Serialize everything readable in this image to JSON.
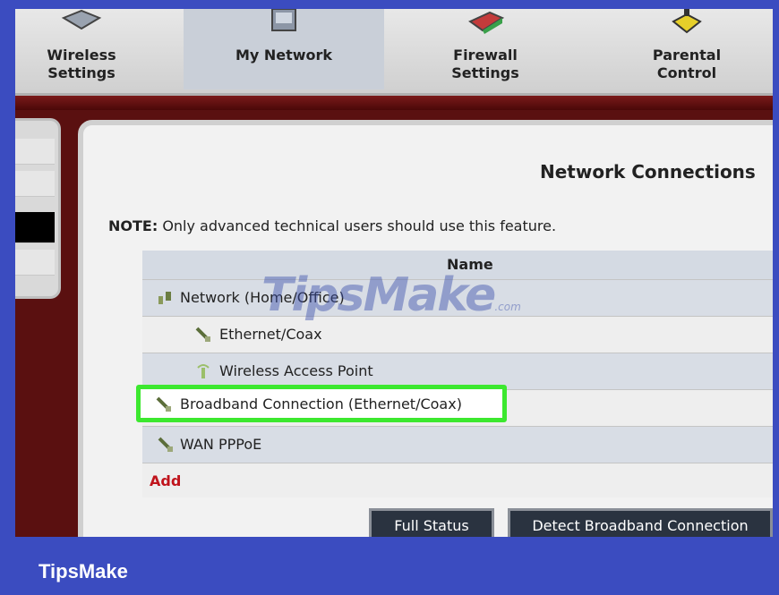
{
  "nav": {
    "items": [
      {
        "label_line1": "Wireless",
        "label_line2": "Settings",
        "icon": "router-icon"
      },
      {
        "label_line1": "My Network",
        "label_line2": "",
        "icon": "computer-icon"
      },
      {
        "label_line1": "Firewall",
        "label_line2": "Settings",
        "icon": "firewall-icon"
      },
      {
        "label_line1": "Parental",
        "label_line2": "Control",
        "icon": "parental-icon"
      }
    ],
    "active_index": 1
  },
  "main": {
    "title": "Network Connections",
    "note_label": "NOTE:",
    "note_text": " Only advanced technical users should use this feature.",
    "table_header": "Name",
    "rows": [
      {
        "label": "Network (Home/Office)",
        "icon": "network-icon"
      },
      {
        "label": "Ethernet/Coax",
        "icon": "cable-icon"
      },
      {
        "label": "Wireless Access Point",
        "icon": "wireless-icon"
      },
      {
        "label": "Broadband Connection (Ethernet/Coax)",
        "icon": "cable-icon",
        "highlighted": true
      },
      {
        "label": "WAN PPPoE",
        "icon": "cable-icon"
      }
    ],
    "add_label": "Add",
    "buttons": {
      "full_status": "Full Status",
      "detect_broadband": "Detect Broadband Connection"
    }
  },
  "watermark": {
    "brand": "TipsMake",
    "suffix": ".com"
  },
  "footer": {
    "brand": "TipsMake"
  },
  "colors": {
    "highlight": "#3ce82f",
    "add": "#c0141c",
    "frame": "#3b4cc0"
  }
}
